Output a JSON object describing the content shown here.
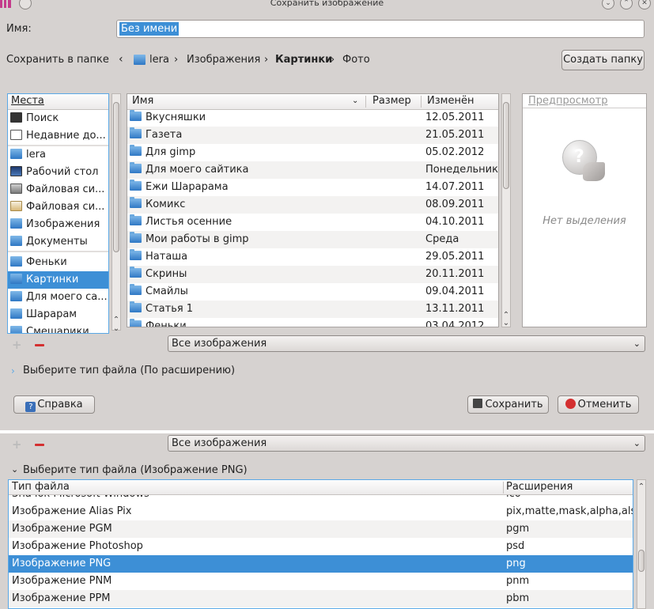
{
  "window": {
    "title": "Сохранить изображение"
  },
  "name_row": {
    "label": "Имя:",
    "value": "Без имени"
  },
  "folder_row": {
    "label": "Сохранить в папке",
    "crumbs": [
      "lera",
      "Изображения",
      "Картинки",
      "Фото"
    ],
    "create_folder": "Создать папку"
  },
  "places": {
    "header": "Места",
    "items": [
      {
        "label": "Поиск",
        "icon": "binoculars-icon"
      },
      {
        "label": "Недавние до...",
        "icon": "recent-icon"
      },
      {
        "label": "lera",
        "icon": "home-folder-icon"
      },
      {
        "label": "Рабочий стол",
        "icon": "desktop-icon"
      },
      {
        "label": "Файловая си...",
        "icon": "harddisk-icon"
      },
      {
        "label": "Файловая си...",
        "icon": "usb-drive-icon"
      },
      {
        "label": "Изображения",
        "icon": "folder-icon"
      },
      {
        "label": "Документы",
        "icon": "folder-icon"
      },
      {
        "label": "Феньки",
        "icon": "folder-icon"
      },
      {
        "label": "Картинки",
        "icon": "folder-icon"
      },
      {
        "label": "Для моего са...",
        "icon": "folder-icon"
      },
      {
        "label": "Шарарам",
        "icon": "folder-icon"
      },
      {
        "label": "Смешарики",
        "icon": "folder-icon"
      }
    ]
  },
  "files": {
    "columns": {
      "name": "Имя",
      "size": "Размер",
      "modified": "Изменён"
    },
    "rows": [
      {
        "name": "Вкусняшки",
        "modified": "12.05.2011"
      },
      {
        "name": "Газета",
        "modified": "21.05.2011"
      },
      {
        "name": "Для gimp",
        "modified": "05.02.2012"
      },
      {
        "name": "Для моего сайтика",
        "modified": "Понедельник"
      },
      {
        "name": "Ежи Шарарама",
        "modified": "14.07.2011"
      },
      {
        "name": "Комикс",
        "modified": "08.09.2011"
      },
      {
        "name": "Листья осенние",
        "modified": "04.10.2011"
      },
      {
        "name": "Мои работы в gimp",
        "modified": "Среда"
      },
      {
        "name": "Наташа",
        "modified": "29.05.2011"
      },
      {
        "name": "Скрины",
        "modified": "20.11.2011"
      },
      {
        "name": "Смайлы",
        "modified": "09.04.2011"
      },
      {
        "name": "Статья 1",
        "modified": "13.11.2011"
      },
      {
        "name": "Феньки",
        "modified": "03.04.2012"
      }
    ]
  },
  "preview": {
    "header": "Предпросмотр",
    "empty_text": "Нет выделения"
  },
  "filter": {
    "value": "Все изображения"
  },
  "filetype_toggle": {
    "label_collapsed": "Выберите тип файла (По расширению)",
    "label_expanded": "Выберите тип файла (Изображение PNG)"
  },
  "buttons": {
    "help": "Справка",
    "save": "Сохранить",
    "cancel": "Отменить"
  },
  "filetypes": {
    "columns": {
      "type": "Тип файла",
      "ext": "Расширения"
    },
    "partial_row": {
      "type": "Значок Microsoft Windows",
      "ext": "ico"
    },
    "rows": [
      {
        "type": "Изображение Alias Pix",
        "ext": "pix,matte,mask,alpha,als"
      },
      {
        "type": "Изображение PGM",
        "ext": "pgm"
      },
      {
        "type": "Изображение Photoshop",
        "ext": "psd"
      },
      {
        "type": "Изображение PNG",
        "ext": "png",
        "selected": true
      },
      {
        "type": "Изображение PNM",
        "ext": "pnm"
      },
      {
        "type": "Изображение PPM",
        "ext": "pbm"
      }
    ]
  },
  "colors": {
    "selection": "#3d8fd6",
    "accent_border": "#5aa8e6",
    "remove": "#d43030"
  }
}
